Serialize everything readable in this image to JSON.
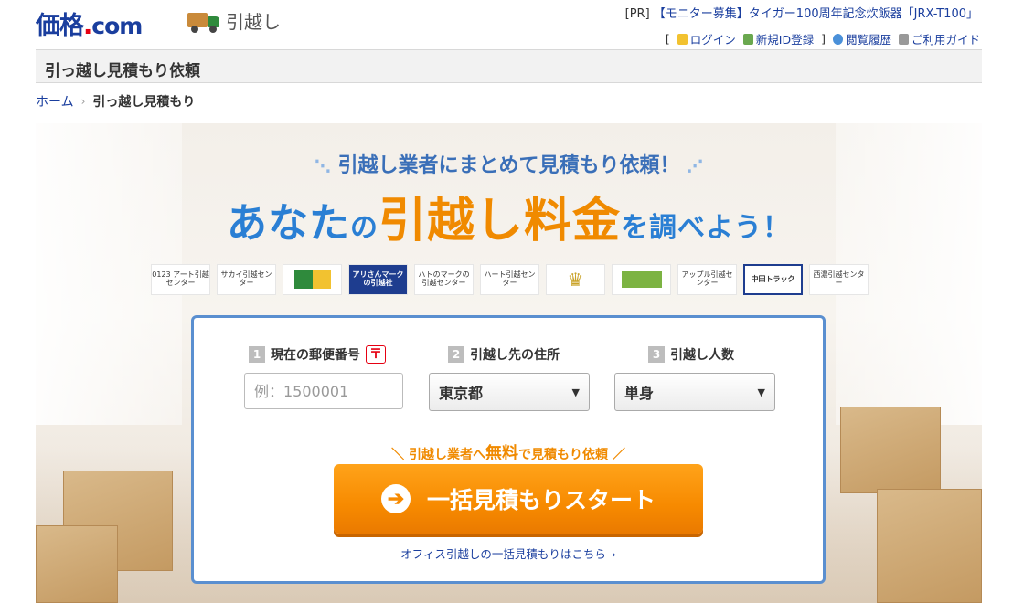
{
  "header": {
    "logo_main": "価格",
    "logo_dot": ".",
    "logo_com": "com",
    "section_name": "引越し",
    "pr_prefix": "[PR]",
    "pr_text": "【モニター募集】タイガー100周年記念炊飯器「JRX-T100」",
    "bracket_open": "[",
    "bracket_close": "]",
    "login": "ログイン",
    "register": "新規ID登録",
    "history": "閲覧履歴",
    "guide": "ご利用ガイド"
  },
  "page_title": "引っ越し見積もり依頼",
  "breadcrumb": {
    "home": "ホーム",
    "sep": "›",
    "current": "引っ越し見積もり"
  },
  "hero": {
    "catch_left": "⋱",
    "catch": "引越し業者にまとめて見積もり依頼！",
    "catch_right": "⋰",
    "headline_a": "あなた",
    "headline_no": "の",
    "headline_b": "引越し料金",
    "headline_c": "を調べよう！",
    "partners": [
      "0123 アート引越センター",
      "サカイ引越センター",
      "",
      "アリさんマークの引越社",
      "ハトのマークの引越センター",
      "ハート引越センター",
      "",
      "",
      "アップル引越センター",
      "中田トラック",
      "西濃引越センター"
    ]
  },
  "form": {
    "step1_num": "1",
    "step1_label": "現在の郵便番号",
    "post_mark": "〒",
    "zip_placeholder": "例：1500001",
    "step2_num": "2",
    "step2_label": "引越し先の住所",
    "prefecture_value": "東京都",
    "step3_num": "3",
    "step3_label": "引越し人数",
    "people_value": "単身",
    "select_arrow": "▼",
    "note_left": "＼",
    "note_a": "引越し業者へ",
    "note_free": "無料",
    "note_b": "で見積もり依頼",
    "note_right": "／",
    "start_icon": "➔",
    "start_label": "一括見積もりスタート",
    "office_link": "オフィス引越しの一括見積もりはこちら",
    "office_chev": "›"
  },
  "colors": {
    "brand_blue": "#1a3e9e",
    "accent_orange": "#f78a00",
    "panel_border": "#5a8fd0"
  }
}
